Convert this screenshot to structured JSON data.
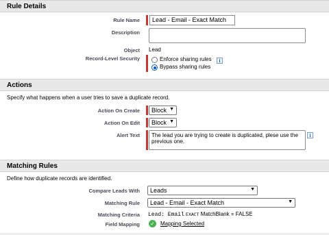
{
  "rule_details": {
    "header": "Rule Details",
    "rule_name_label": "Rule Name",
    "rule_name_value": "Lead - Email - Exact Match",
    "description_label": "Description",
    "description_value": "",
    "object_label": "Object",
    "object_value": "Lead",
    "record_security_label": "Record-Level Security",
    "option_enforce": "Enforce sharing rules",
    "option_bypass": "Bypass sharing rules",
    "info_icon": "i"
  },
  "actions": {
    "header": "Actions",
    "description": "Specify what happens when a user tries to save a duplicate record.",
    "on_create_label": "Action On Create",
    "on_create_value": "Block",
    "on_edit_label": "Action On Edit",
    "on_edit_value": "Block",
    "alert_text_label": "Alert Text",
    "alert_text_value": "The lead you are trying to create is duplicated, plese use the previous one."
  },
  "matching_rules": {
    "header": "Matching Rules",
    "description": "Define how duplicate records are identified.",
    "compare_label": "Compare Leads With",
    "compare_value": "Leads",
    "matching_rule_label": "Matching Rule",
    "matching_rule_value": "Lead - Email - Exact Match",
    "criteria_label": "Matching Criteria",
    "criteria_field": "Lead: Email",
    "criteria_exact": "EXACT",
    "criteria_rest": "MatchBlank = FALSE",
    "field_mapping_label": "Field Mapping",
    "field_mapping_link": "Mapping Selected"
  },
  "colors": {
    "required_bar": "#c23934",
    "header_bg": "#e8e8e8",
    "success_icon": "#4bb04f"
  }
}
